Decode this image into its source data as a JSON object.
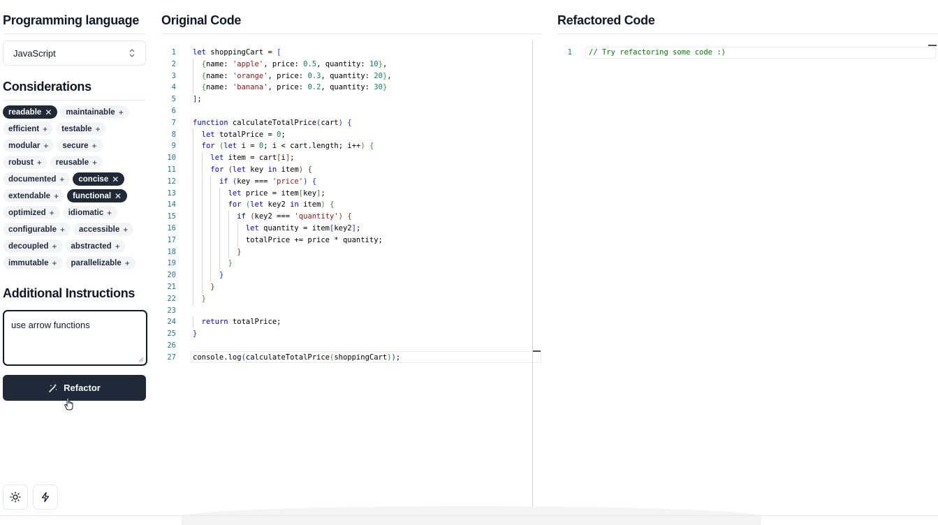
{
  "sidebar": {
    "language_title": "Programming language",
    "language_selected": "JavaScript",
    "considerations_title": "Considerations",
    "considerations": [
      {
        "label": "readable",
        "selected": true
      },
      {
        "label": "maintainable",
        "selected": false
      },
      {
        "label": "efficient",
        "selected": false
      },
      {
        "label": "testable",
        "selected": false
      },
      {
        "label": "modular",
        "selected": false
      },
      {
        "label": "secure",
        "selected": false
      },
      {
        "label": "robust",
        "selected": false
      },
      {
        "label": "reusable",
        "selected": false
      },
      {
        "label": "documented",
        "selected": false
      },
      {
        "label": "concise",
        "selected": true
      },
      {
        "label": "extendable",
        "selected": false
      },
      {
        "label": "functional",
        "selected": true
      },
      {
        "label": "optimized",
        "selected": false
      },
      {
        "label": "idiomatic",
        "selected": false
      },
      {
        "label": "configurable",
        "selected": false
      },
      {
        "label": "accessible",
        "selected": false
      },
      {
        "label": "decoupled",
        "selected": false
      },
      {
        "label": "abstracted",
        "selected": false
      },
      {
        "label": "immutable",
        "selected": false
      },
      {
        "label": "parallelizable",
        "selected": false
      }
    ],
    "instructions_title": "Additional Instructions",
    "instructions_value": "use arrow functions",
    "refactor_label": "Refactor",
    "theme_icon": "sun-icon",
    "bolt_icon": "bolt-icon"
  },
  "original": {
    "title": "Original Code",
    "lines": [
      "let shoppingCart = [",
      "  {name: 'apple', price: 0.5, quantity: 10},",
      "  {name: 'orange', price: 0.3, quantity: 20},",
      "  {name: 'banana', price: 0.2, quantity: 30}",
      "];",
      "",
      "function calculateTotalPrice(cart) {",
      "  let totalPrice = 0;",
      "  for (let i = 0; i < cart.length; i++) {",
      "    let item = cart[i];",
      "    for (let key in item) {",
      "      if (key === 'price') {",
      "        let price = item[key];",
      "        for (let key2 in item) {",
      "          if (key2 === 'quantity') {",
      "            let quantity = item[key2];",
      "            totalPrice += price * quantity;",
      "          }",
      "        }",
      "      }",
      "    }",
      "  }",
      "",
      "  return totalPrice;",
      "}",
      "",
      "console.log(calculateTotalPrice(shoppingCart));"
    ]
  },
  "refactored": {
    "title": "Refactored Code",
    "lines": [
      "// Try refactoring some code :)"
    ]
  },
  "colors": {
    "accent_dark": "#1f2937",
    "keyword": "#0000ff",
    "string": "#a31515",
    "number": "#098658",
    "comment": "#008000",
    "line_number": "#237893"
  }
}
